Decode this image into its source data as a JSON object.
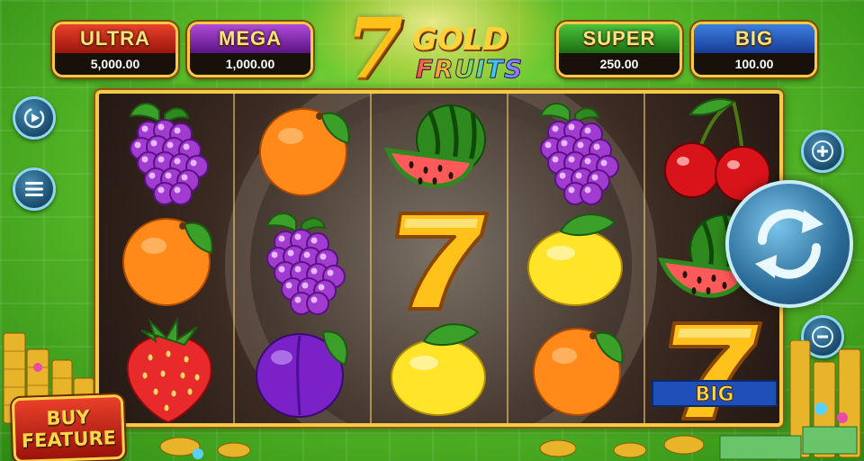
{
  "game": {
    "logo_seven": "7",
    "logo_gold": "GOLD",
    "logo_fruits": "FRUITS"
  },
  "jackpots": [
    {
      "label": "ULTRA",
      "value": "5,000.00",
      "color": "#c0281a"
    },
    {
      "label": "MEGA",
      "value": "1,000.00",
      "color": "#7a22a8"
    },
    {
      "label": "SUPER",
      "value": "250.00",
      "color": "#2e8a1e"
    },
    {
      "label": "BIG",
      "value": "100.00",
      "color": "#1f4fb8"
    }
  ],
  "reels": [
    [
      "grapes",
      "orange",
      "strawberry"
    ],
    [
      "orange",
      "grapes",
      "plum"
    ],
    [
      "watermelon",
      "seven",
      "lemon"
    ],
    [
      "grapes",
      "lemon",
      "orange"
    ],
    [
      "cherry",
      "watermelon",
      "seven-big"
    ]
  ],
  "big_symbol_label": "BIG",
  "controls": {
    "autoplay_icon": "autoplay-icon",
    "menu_icon": "menu-icon",
    "bet_increase_icon": "plus-icon",
    "bet_decrease_icon": "minus-icon",
    "spin_icon": "spin-arrows-icon"
  },
  "buy_feature": {
    "line1": "BUY",
    "line2": "FEATURE"
  }
}
